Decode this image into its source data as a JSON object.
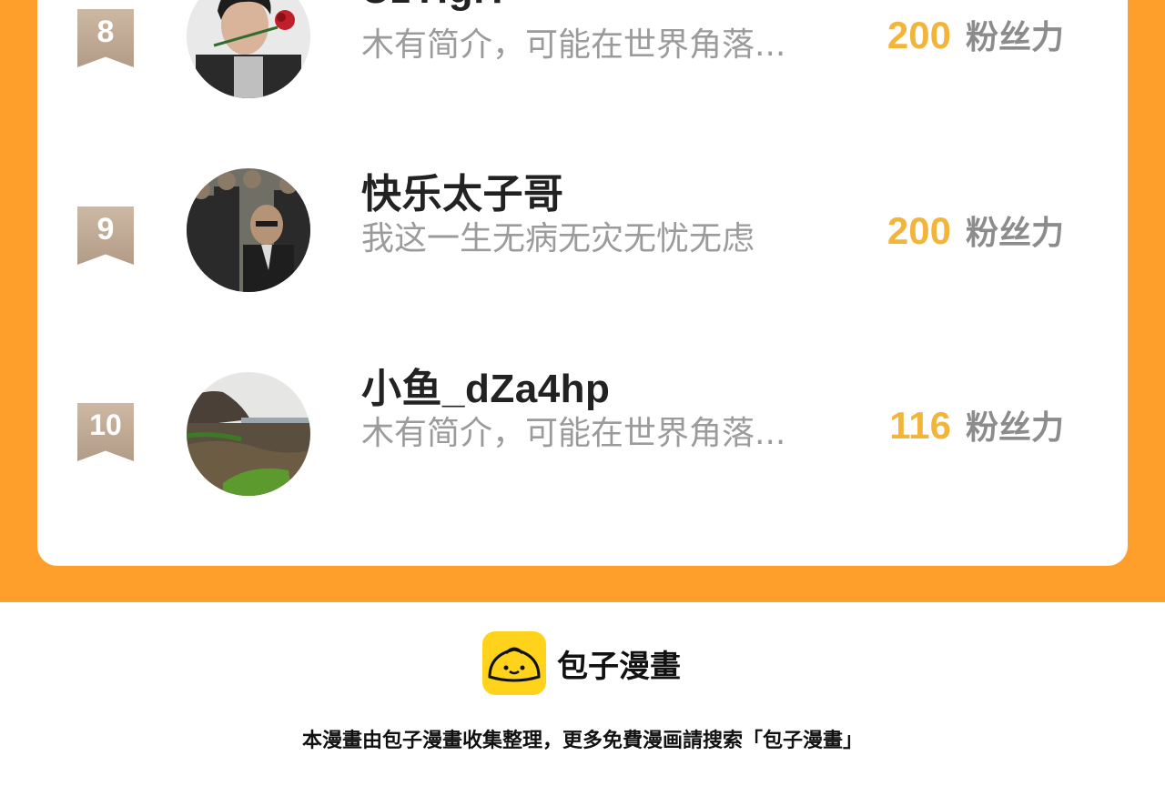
{
  "ranking": {
    "fans_label": "粉丝力",
    "items": [
      {
        "rank": "8",
        "name": "UzYigiT",
        "description": "木有简介，可能在世界角落...",
        "fans": "200",
        "avatar": "man-with-rose-avatar"
      },
      {
        "rank": "9",
        "name": "快乐太子哥",
        "description": "我这一生无病无灾无忧无虑",
        "fans": "200",
        "avatar": "comic-suits-avatar"
      },
      {
        "rank": "10",
        "name": "小鱼_dZa4hp",
        "description": "木有简介，可能在世界角落...",
        "fans": "116",
        "avatar": "seaside-rocks-avatar"
      }
    ]
  },
  "brand": {
    "name": "包子漫畫",
    "footer": "本漫畫由包子漫畫收集整理，更多免費漫画請搜索「包子漫畫」"
  },
  "colors": {
    "orange": "#ff9f2b",
    "gold": "#f2b53a",
    "rank_badge": "#c2ac96",
    "logo_yellow": "#ffd21c"
  }
}
